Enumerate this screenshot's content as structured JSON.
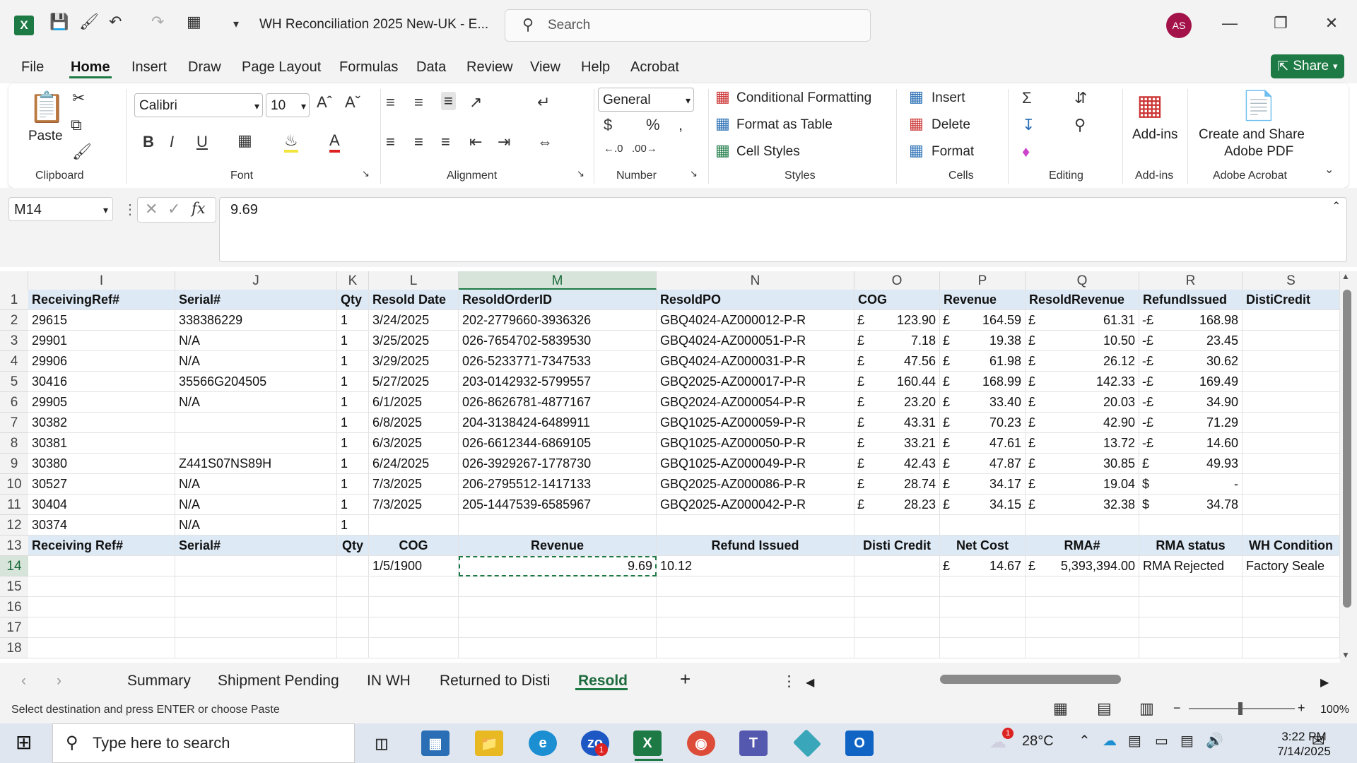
{
  "titlebar": {
    "doc_title": "WH Reconciliation 2025 New-UK  -  E...",
    "search_placeholder": "Search",
    "avatar_initials": "AS"
  },
  "menu": {
    "tabs": [
      "File",
      "Home",
      "Insert",
      "Draw",
      "Page Layout",
      "Formulas",
      "Data",
      "Review",
      "View",
      "Help",
      "Acrobat"
    ],
    "share_label": "Share"
  },
  "ribbon": {
    "paste_label": "Paste",
    "font_name": "Calibri",
    "font_size": "10",
    "number_format": "General",
    "conditional_formatting": "Conditional Formatting",
    "format_as_table": "Format as Table",
    "cell_styles": "Cell Styles",
    "insert": "Insert",
    "delete": "Delete",
    "format": "Format",
    "addins": "Add-ins",
    "create_share_1": "Create and Share",
    "create_share_2": "Adobe PDF",
    "groups": {
      "clipboard": "Clipboard",
      "font": "Font",
      "alignment": "Alignment",
      "number": "Number",
      "styles": "Styles",
      "cells": "Cells",
      "editing": "Editing",
      "addins": "Add-ins",
      "acrobat": "Adobe Acrobat"
    }
  },
  "formula_bar": {
    "name_box": "M14",
    "fx": "fx",
    "value": "9.69"
  },
  "grid": {
    "columns": [
      "I",
      "J",
      "K",
      "L",
      "M",
      "N",
      "O",
      "P",
      "Q",
      "R",
      "S"
    ],
    "rows": [
      "1",
      "2",
      "3",
      "4",
      "5",
      "6",
      "7",
      "8",
      "9",
      "10",
      "11",
      "12",
      "13",
      "14",
      "15",
      "16",
      "17",
      "18"
    ],
    "header1": [
      "ReceivingRef#",
      "Serial#",
      "Qty",
      "Resold Date",
      "ResoldOrderID",
      "ResoldPO",
      "COG",
      "Revenue",
      "ResoldRevenue",
      "RefundIssued",
      "DistiCredit"
    ],
    "data": [
      [
        "29615",
        "338386229",
        "1",
        "3/24/2025",
        "202-2779660-3936326",
        "GBQ4024-AZ000012-P-R",
        "123.90",
        "164.59",
        "61.31",
        "168.98"
      ],
      [
        "29901",
        "N/A",
        "1",
        "3/25/2025",
        "026-7654702-5839530",
        "GBQ4024-AZ000051-P-R",
        "7.18",
        "19.38",
        "10.50",
        "23.45"
      ],
      [
        "29906",
        "N/A",
        "1",
        "3/29/2025",
        "026-5233771-7347533",
        "GBQ4024-AZ000031-P-R",
        "47.56",
        "61.98",
        "26.12",
        "30.62"
      ],
      [
        "30416",
        "35566G204505",
        "1",
        "5/27/2025",
        "203-0142932-5799557",
        "GBQ2025-AZ000017-P-R",
        "160.44",
        "168.99",
        "142.33",
        "169.49"
      ],
      [
        "29905",
        "N/A",
        "1",
        "6/1/2025",
        "026-8626781-4877167",
        "GBQ2024-AZ000054-P-R",
        "23.20",
        "33.40",
        "20.03",
        "34.90"
      ],
      [
        "30382",
        "",
        "1",
        "6/8/2025",
        "204-3138424-6489911",
        "GBQ1025-AZ000059-P-R",
        "43.31",
        "70.23",
        "42.90",
        "71.29"
      ],
      [
        "30381",
        "",
        "1",
        "6/3/2025",
        "026-6612344-6869105",
        "GBQ1025-AZ000050-P-R",
        "33.21",
        "47.61",
        "13.72",
        "14.60"
      ],
      [
        "30380",
        "Z441S07NS89H",
        "1",
        "6/24/2025",
        "026-3929267-1778730",
        "GBQ1025-AZ000049-P-R",
        "42.43",
        "47.87",
        "30.85",
        "49.93"
      ],
      [
        "30527",
        "N/A",
        "1",
        "7/3/2025",
        "206-2795512-1417133",
        "GBQ2025-AZ000086-P-R",
        "28.74",
        "34.17",
        "19.04",
        "-"
      ],
      [
        "30404",
        "N/A",
        "1",
        "7/3/2025",
        "205-1447539-6585967",
        "GBQ2025-AZ000042-P-R",
        "28.23",
        "34.15",
        "32.38",
        "34.78"
      ]
    ],
    "refund_prefix": [
      "-£",
      "-£",
      "-£",
      "-£",
      "-£",
      "-£",
      "-£",
      "£",
      "$",
      "$"
    ],
    "row12": [
      "30374",
      "N/A",
      "1"
    ],
    "header13": [
      "Receiving Ref#",
      "Serial#",
      "Qty",
      "COG",
      "Revenue",
      "Refund Issued",
      "Disti Credit",
      "Net Cost",
      "RMA#",
      "RMA status",
      "WH Condition"
    ],
    "row14": {
      "L": "1/5/1900",
      "M": "9.69",
      "N": "10.12",
      "P": "14.67",
      "Q": "5,393,394.00",
      "R": "RMA Rejected",
      "S": "Factory Seale"
    },
    "currency": "£"
  },
  "sheets": {
    "tabs": [
      "Summary",
      "Shipment Pending",
      "IN WH",
      "Returned to Disti",
      "Resold"
    ],
    "active": "Resold"
  },
  "status": {
    "message": "Select destination and press ENTER or choose Paste",
    "zoom": "100%"
  },
  "taskbar": {
    "search_placeholder": "Type here to search",
    "weather": "28°C",
    "time": "3:22 PM",
    "date": "7/14/2025",
    "notif_count": "1",
    "weather_badge": "1"
  }
}
